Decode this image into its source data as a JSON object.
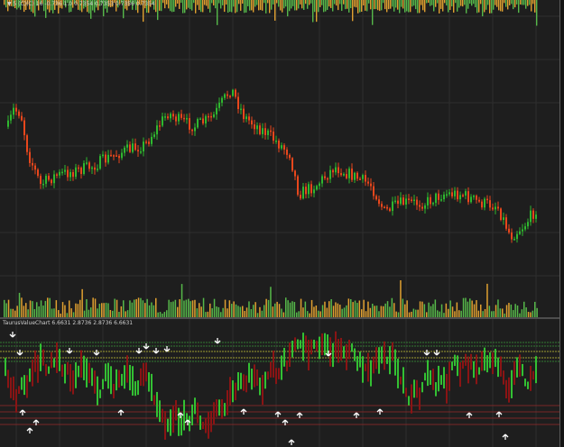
{
  "header": {
    "main_legend": "▼ 5 (C)(C) 16 -0.736 1.0 0.7354 0.7353 0.7356 0.7354",
    "indicator_legend": "TaurusValueChart 6.6631 2.8736 2.8736 6.6631"
  },
  "colors": {
    "background": "#1e1e1e",
    "grid": "#2e2e2e",
    "bull": "#2fb82f",
    "bear": "#e8471c",
    "volume_up": "#56b84a",
    "volume_down": "#e0a030",
    "value_up": "#33c033",
    "value_down": "#8a1414",
    "arrow": "#ffffff",
    "level_green": "#3a9a3a",
    "level_yellow": "#c8c83a",
    "level_red": "#9a2a2a"
  },
  "icons": {
    "buy_signal": "arrow-up-icon",
    "sell_signal": "arrow-down-icon"
  }
}
